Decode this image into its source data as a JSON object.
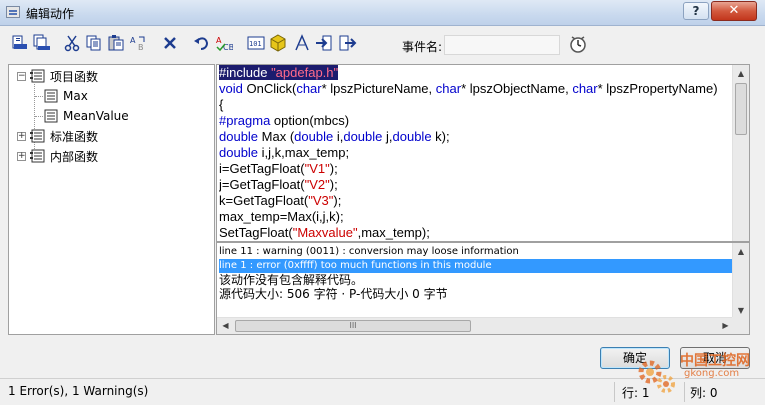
{
  "window": {
    "title": "编辑动作",
    "help_label": "?",
    "close_label": "✕"
  },
  "toolbar": {
    "event_name_label": "事件名:",
    "event_name_value": "",
    "icons": [
      "compile-icon",
      "compile-all-icon",
      "cut-icon",
      "copy-icon",
      "paste-icon",
      "replace-icon",
      "delete-icon",
      "undo-icon",
      "spellcheck-icon",
      "insert-function-icon",
      "object-icon",
      "syntax-icon",
      "import-icon",
      "export-icon",
      "trigger-clock-icon"
    ]
  },
  "tree": {
    "items": [
      {
        "label": "项目函数",
        "expander": "−"
      },
      {
        "label": "Max"
      },
      {
        "label": "MeanValue"
      },
      {
        "label": "标准函数",
        "expander": "+"
      },
      {
        "label": "内部函数",
        "expander": "+"
      }
    ]
  },
  "code": {
    "line1_keyword": "#include",
    "line1_string": "\"apdefap.h\"",
    "line2_void": "void",
    "line2_rest1": " OnClick(",
    "line2_char1": "char",
    "line2_rest2": "* lpszPictureName, ",
    "line2_char2": "char",
    "line2_rest3": "* lpszObjectName, ",
    "line2_char3": "char",
    "line2_rest4": "* lpszPropertyName)",
    "line3": "{",
    "line4_keyword": "#pragma",
    "line4_rest": " option(mbcs)",
    "line5_double1": "double",
    "line5_rest1": " Max (",
    "line5_double2": "double",
    "line5_rest2": " i,",
    "line5_double3": "double",
    "line5_rest3": " j,",
    "line5_double4": "double",
    "line5_rest4": " k);",
    "line6_double": "double",
    "line6_rest": " i,j,k,max_temp;",
    "line7_pre": "i=GetTagFloat(",
    "line7_str": "\"V1\"",
    "line7_post": ");",
    "line8_pre": "j=GetTagFloat(",
    "line8_str": "\"V2\"",
    "line8_post": ");",
    "line9_pre": "k=GetTagFloat(",
    "line9_str": "\"V3\"",
    "line9_post": ");",
    "line10": "max_temp=Max(i,j,k);",
    "line11_pre": "SetTagFloat(",
    "line11_str": "\"Maxvalue\"",
    "line11_post": ",max_temp);"
  },
  "output": {
    "warning": "line 11 : warning (0011) : conversion may loose information",
    "error": "line 1 : error (0xffff) too much functions in this module",
    "no_comment": "该动作没有包含解释代码。",
    "size_info": "源代码大小: 506 字符 · P-代码大小 0 字节",
    "hscroll_grip": "III"
  },
  "buttons": {
    "ok": "确定",
    "cancel": "取消"
  },
  "status": {
    "message": "1 Error(s), 1 Warning(s)",
    "row_label": "行: 1",
    "col_label": "列: 0"
  },
  "watermark": {
    "line1": "中国工控网",
    "line2": "gkong.com"
  },
  "colors": {
    "keyword": "#0000cc",
    "string": "#cc0000",
    "selection": "#3399ff",
    "close_button": "#c2361c"
  }
}
